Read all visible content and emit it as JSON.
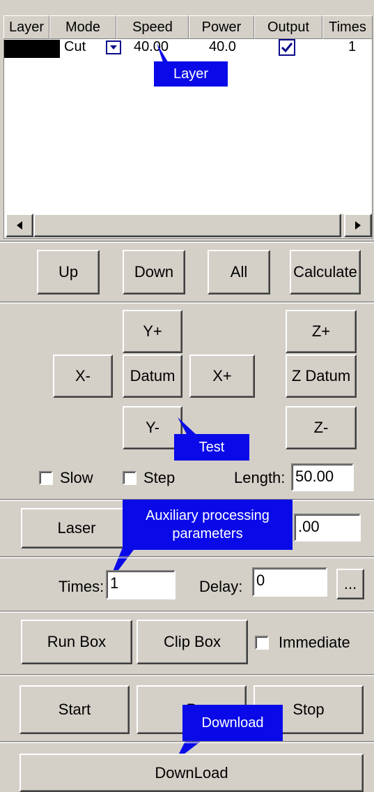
{
  "layer_table": {
    "columns": [
      "Layer",
      "Mode",
      "Speed",
      "Power",
      "Output",
      "Times"
    ],
    "rows": [
      {
        "layer_color": "#000000",
        "mode": "Cut",
        "speed": "40.00",
        "power": "40.0",
        "output": true,
        "times": "1"
      }
    ]
  },
  "hscroll": {
    "left_arrow": "◀",
    "right_arrow": "▶"
  },
  "layer_buttons": {
    "up": "Up",
    "down": "Down",
    "all": "All",
    "calculate": "Calculate"
  },
  "jog": {
    "y_plus": "Y+",
    "y_minus": "Y-",
    "x_minus": "X-",
    "x_plus": "X+",
    "datum": "Datum",
    "z_plus": "Z+",
    "z_datum": "Z Datum",
    "z_minus": "Z-",
    "slow_label": "Slow",
    "step_label": "Step",
    "length_label": "Length:",
    "length_value": "50.00"
  },
  "laser": {
    "button": "Laser",
    "value": ".00"
  },
  "aux": {
    "times_label": "Times:",
    "times_value": "1",
    "delay_label": "Delay:",
    "delay_value": "0",
    "more": "..."
  },
  "box": {
    "run_box": "Run Box",
    "clip_box": "Clip Box",
    "immediate_label": "Immediate"
  },
  "control": {
    "start": "Start",
    "pause": "P",
    "stop": "Stop"
  },
  "download_button": "DownLoad",
  "callouts": {
    "layer": "Layer",
    "test": "Test",
    "auxiliary": "Auxiliary processing parameters",
    "download": "Download"
  },
  "colors": {
    "callout_bg": "#0a0ae8",
    "panel_bg": "#d4d0c8",
    "check_mark": "#0a0a8a"
  }
}
